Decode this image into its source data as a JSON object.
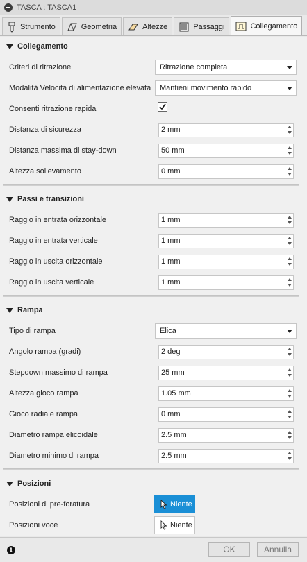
{
  "window": {
    "title": "TASCA : TASCA1"
  },
  "tabs": [
    {
      "label": "Strumento"
    },
    {
      "label": "Geometria"
    },
    {
      "label": "Altezze"
    },
    {
      "label": "Passaggi"
    },
    {
      "label": "Collegamento"
    }
  ],
  "sections": {
    "collegamento": {
      "title": "Collegamento",
      "criteri_label": "Criteri di ritrazione",
      "criteri_value": "Ritrazione completa",
      "modalita_label": "Modalità Velocità di alimentazione elevata",
      "modalita_value": "Mantieni movimento rapido",
      "consenti_label": "Consenti ritrazione rapida",
      "consenti_checked": true,
      "distanza_sicurezza_label": "Distanza di sicurezza",
      "distanza_sicurezza_value": "2 mm",
      "distanza_staydown_label": "Distanza massima di stay-down",
      "distanza_staydown_value": "50 mm",
      "altezza_sollevamento_label": "Altezza sollevamento",
      "altezza_sollevamento_value": "0 mm"
    },
    "passi": {
      "title": "Passi e transizioni",
      "r_entrata_orizz_label": "Raggio in entrata orizzontale",
      "r_entrata_orizz_value": "1 mm",
      "r_entrata_vert_label": "Raggio in entrata verticale",
      "r_entrata_vert_value": "1 mm",
      "r_uscita_orizz_label": "Raggio in uscita orizzontale",
      "r_uscita_orizz_value": "1 mm",
      "r_uscita_vert_label": "Raggio in uscita verticale",
      "r_uscita_vert_value": "1 mm"
    },
    "rampa": {
      "title": "Rampa",
      "tipo_label": "Tipo di rampa",
      "tipo_value": "Elica",
      "angolo_label": "Angolo rampa (gradi)",
      "angolo_value": "2 deg",
      "stepdown_label": "Stepdown massimo di rampa",
      "stepdown_value": "25 mm",
      "altezza_gioco_label": "Altezza gioco rampa",
      "altezza_gioco_value": "1.05 mm",
      "gioco_radiale_label": "Gioco radiale rampa",
      "gioco_radiale_value": "0 mm",
      "diametro_elicoidale_label": "Diametro rampa elicoidale",
      "diametro_elicoidale_value": "2.5 mm",
      "diametro_minimo_label": "Diametro minimo di rampa",
      "diametro_minimo_value": "2.5 mm"
    },
    "posizioni": {
      "title": "Posizioni",
      "preforatura_label": "Posizioni di pre-foratura",
      "preforatura_button": "Niente",
      "voce_label": "Posizioni voce",
      "voce_button": "Niente"
    }
  },
  "footer": {
    "ok_label": "OK",
    "cancel_label": "Annulla"
  },
  "colors": {
    "accent": "#1a8fd6"
  }
}
